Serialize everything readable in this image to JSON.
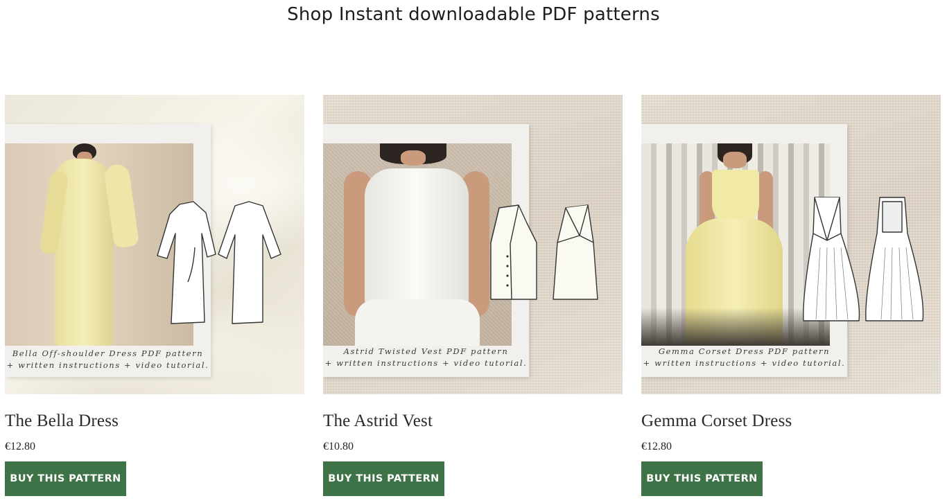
{
  "page": {
    "heading": "Shop Instant downloadable PDF patterns"
  },
  "products": [
    {
      "title": "The Bella Dress",
      "price": "€12.80",
      "button_label": "BUY THIS PATTERN",
      "caption_line1": "Bella Off-shoulder Dress PDF pattern",
      "caption_line2": "+ written instructions + video tutorial."
    },
    {
      "title": "The Astrid Vest",
      "price": "€10.80",
      "button_label": "BUY THIS PATTERN",
      "caption_line1": "Astrid Twisted Vest PDF pattern",
      "caption_line2": "+ written instructions + video tutorial."
    },
    {
      "title": "Gemma Corset Dress",
      "price": "€12.80",
      "button_label": "BUY THIS PATTERN",
      "caption_line1": "Gemma Corset Dress PDF pattern",
      "caption_line2": "+ written instructions + video tutorial."
    }
  ],
  "colors": {
    "button_bg": "#3d7346",
    "button_text": "#ffffff",
    "text": "#222222"
  }
}
